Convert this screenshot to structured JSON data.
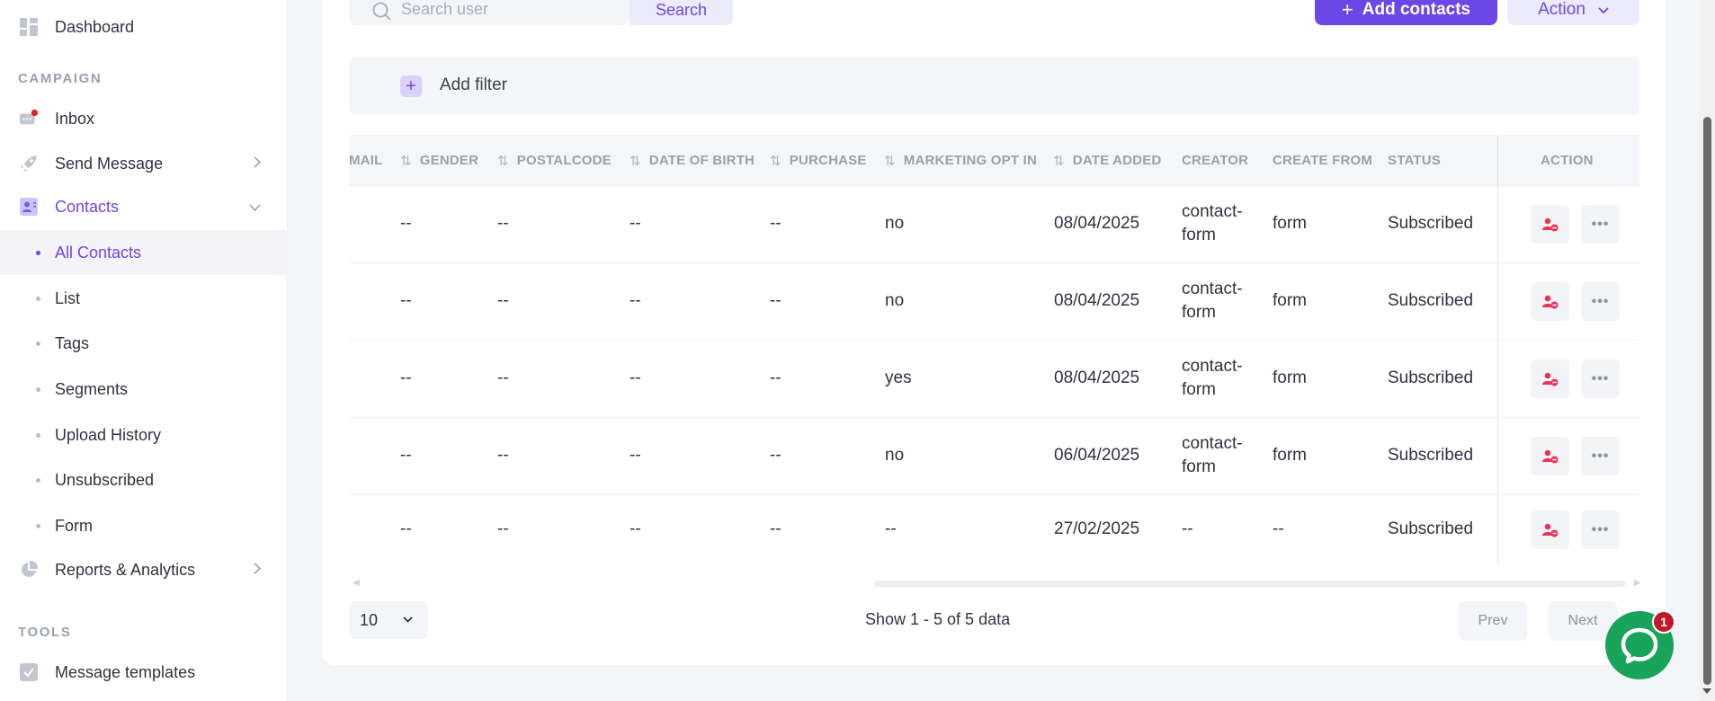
{
  "sidebar": {
    "dashboard": "Dashboard",
    "section_campaign": "CAMPAIGN",
    "inbox": "Inbox",
    "send_message": "Send Message",
    "contacts": "Contacts",
    "contacts_sub": [
      "All Contacts",
      "List",
      "Tags",
      "Segments",
      "Upload History",
      "Unsubscribed",
      "Form"
    ],
    "reports": "Reports & Analytics",
    "section_tools": "TOOLS",
    "message_templates": "Message templates",
    "accent_color": "#6c47e6",
    "notification_color": "#e8202a"
  },
  "toolbar": {
    "search_placeholder": "Search user",
    "search_button": "Search",
    "add_contacts": "Add contacts",
    "action": "Action",
    "add_filter": "Add filter"
  },
  "table": {
    "headers": {
      "email": "MAIL",
      "gender": "GENDER",
      "postalcode": "POSTALCODE",
      "date_of_birth": "DATE OF BIRTH",
      "purchase": "PURCHASE",
      "marketing_opt_in": "MARKETING OPT IN",
      "date_added": "DATE ADDED",
      "creator": "CREATOR",
      "create_from": "CREATE FROM",
      "status": "STATUS",
      "action": "ACTION"
    },
    "rows": [
      {
        "gender": "--",
        "postalcode": "--",
        "dob": "--",
        "purchase": "--",
        "opt_in": "no",
        "date_added": "08/04/2025",
        "creator_1": "contact-",
        "creator_2": "form",
        "create_from": "form",
        "status": "Subscribed"
      },
      {
        "gender": "--",
        "postalcode": "--",
        "dob": "--",
        "purchase": "--",
        "opt_in": "no",
        "date_added": "08/04/2025",
        "creator_1": "contact-",
        "creator_2": "form",
        "create_from": "form",
        "status": "Subscribed"
      },
      {
        "gender": "--",
        "postalcode": "--",
        "dob": "--",
        "purchase": "--",
        "opt_in": "yes",
        "date_added": "08/04/2025",
        "creator_1": "contact-",
        "creator_2": "form",
        "create_from": "form",
        "status": "Subscribed"
      },
      {
        "gender": "--",
        "postalcode": "--",
        "dob": "--",
        "purchase": "--",
        "opt_in": "no",
        "date_added": "06/04/2025",
        "creator_1": "contact-",
        "creator_2": "form",
        "create_from": "form",
        "status": "Subscribed"
      },
      {
        "gender": "--",
        "postalcode": "--",
        "dob": "--",
        "purchase": "--",
        "opt_in": "--",
        "date_added": "27/02/2025",
        "creator_1": "--",
        "creator_2": "",
        "create_from": "--",
        "status": "Subscribed"
      }
    ],
    "icons": {
      "unsubscribe": "user-remove-icon",
      "more": "more-dots-icon"
    },
    "unsubscribe_icon_color": "#e8365a"
  },
  "footer": {
    "page_size": "10",
    "show_info": "Show 1 - 5 of 5 data",
    "prev": "Prev",
    "next": "Next"
  },
  "chat": {
    "badge_count": "1",
    "color": "#1aa35b"
  }
}
